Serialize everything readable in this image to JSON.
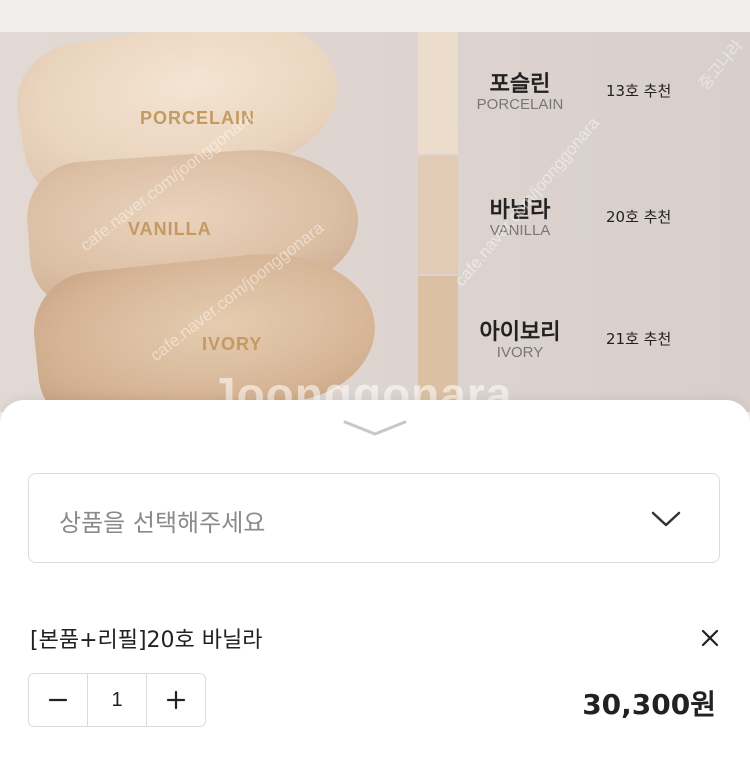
{
  "product_image": {
    "swatch_labels": [
      "PORCELAIN",
      "VANILLA",
      "IVORY"
    ],
    "shades": [
      {
        "name_kr": "포슬린",
        "name_en": "PORCELAIN",
        "recommendation": "13호 추천"
      },
      {
        "name_kr": "바닐라",
        "name_en": "VANILLA",
        "recommendation": "20호 추천"
      },
      {
        "name_kr": "아이보리",
        "name_en": "IVORY",
        "recommendation": "21호 추천"
      }
    ],
    "watermarks": {
      "big": "Joonggonara",
      "small_1": "cafe.naver.com/joonggonara",
      "small_2": "cafe.naver.com/joonggonara",
      "small_3": "cafe.naver.com/joonggonara",
      "corner": "중고나라"
    }
  },
  "sheet": {
    "select_placeholder": "상품을 선택해주세요",
    "selected_option": {
      "name": "[본품+리필]20호 바닐라",
      "quantity": "1",
      "price": "30,300원"
    },
    "stepper": {
      "minus": "−",
      "plus": "+"
    }
  },
  "icons": [
    "chevron-down-icon",
    "close-icon",
    "minus-icon",
    "plus-icon",
    "handle-chevron-icon"
  ],
  "colors": {
    "accent_label": "#c49a63",
    "sheet_bg": "#ffffff",
    "border": "#dcdcdc"
  }
}
